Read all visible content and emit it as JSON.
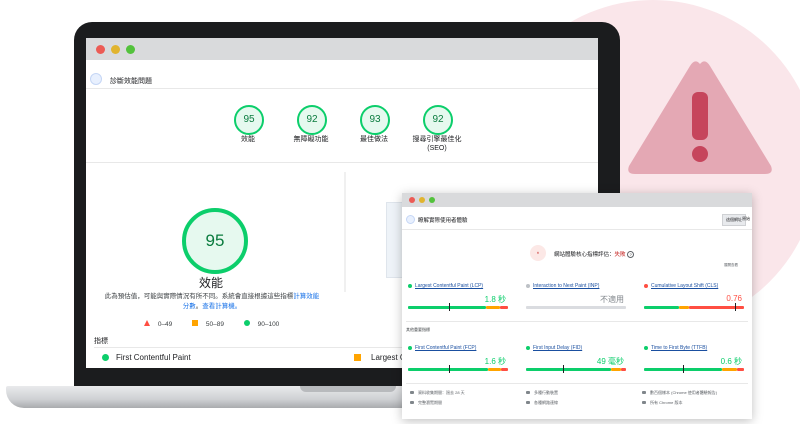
{
  "colors": {
    "pass": "#0cce6b",
    "average": "#ffa400",
    "fail": "#ff4e42",
    "accent": "#c6455c"
  },
  "report": {
    "header_title": "診斷效能問題",
    "scores": [
      {
        "value": "95",
        "label": "效能"
      },
      {
        "value": "92",
        "label": "無障礙功能"
      },
      {
        "value": "93",
        "label": "最佳做法"
      },
      {
        "value": "92",
        "label": "搜尋引擎最佳化",
        "sublabel": "(SEO)"
      }
    ],
    "main_score": "95",
    "main_label": "效能",
    "desc_text": "此為預估值，可能與實際情況有所不同。系統會直接根據這些指標",
    "desc_link1": "計算效能分數",
    "desc_sep": "。",
    "desc_link2": "查看計算機。",
    "legend": [
      {
        "label": "0–49"
      },
      {
        "label": "50–89"
      },
      {
        "label": "90–100"
      }
    ],
    "metrics_title": "指標",
    "metric_first": "First Contentful Paint",
    "metric_second": "Largest Cont"
  },
  "popup": {
    "header_title": "瞭解實際使用者體驗",
    "tabs": [
      "這個網址",
      "原始"
    ],
    "assessment_text": "網站體驗核心指標評估：",
    "assessment_result": "失敗",
    "expand_link": "展開查看",
    "core_metrics": [
      {
        "name": "Largest Contentful Paint (LCP)",
        "value": "1.8 秒",
        "status": "pass",
        "marker": 0.42,
        "split": [
          0.78,
          0.14,
          0.08
        ]
      },
      {
        "name": "Interaction to Next Paint (INP)",
        "value": "不適用",
        "status": "na",
        "marker": 0,
        "split": [
          0,
          0,
          0
        ]
      },
      {
        "name": "Cumulative Layout Shift (CLS)",
        "value": "0.76",
        "status": "fail",
        "marker": 0.92,
        "split": [
          0.35,
          0.1,
          0.55
        ]
      }
    ],
    "other_title": "其他重要指標",
    "other_metrics": [
      {
        "name": "First Contentful Paint (FCP)",
        "value": "1.6 秒",
        "status": "pass",
        "marker": 0.42,
        "split": [
          0.8,
          0.13,
          0.07
        ]
      },
      {
        "name": "First Input Delay (FID)",
        "value": "49 毫秒",
        "status": "pass",
        "marker": 0.38,
        "split": [
          0.85,
          0.1,
          0.05
        ]
      },
      {
        "name": "Time to First Byte (TTFB)",
        "value": "0.6 秒",
        "status": "pass",
        "marker": 0.4,
        "split": [
          0.78,
          0.15,
          0.07
        ]
      }
    ],
    "footer_items": [
      "資料收集期間：過去 28 天",
      "多種行動裝置",
      "數百個樣本 (Chrome 使用者體驗報告)",
      "完整瀏覽期間",
      "各種網路連線",
      "所有 Chrome 版本"
    ]
  }
}
